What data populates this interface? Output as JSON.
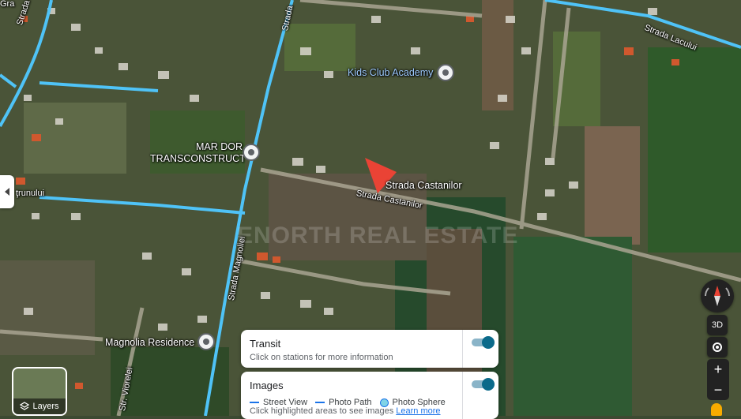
{
  "map": {
    "street_labels": {
      "strada_hoiia": "Strada Hoiia",
      "strada_lacului": "Strada Lacului",
      "strada_castanilor": "Strada Castanilor",
      "strada_magnoliei": "Strada Magnoliei",
      "str_viorelei": "Str. Viorelei",
      "gra": "Gra",
      "frunului": "ţrunului",
      "strada_top": "Strada"
    },
    "places": {
      "kids_club": "Kids Club Academy",
      "mar_dor_line1": "MAR DOR",
      "mar_dor_line2": "TRANSCONSTRUCT",
      "magnolia": "Magnolia Residence",
      "pin_label": "Strada Castanilor"
    },
    "watermark": "ENORTH REAL ESTATE",
    "colors": {
      "road_highlight": "#4fc3f7",
      "pin": "#ea4335"
    }
  },
  "controls": {
    "compass_icon": "compass-icon",
    "btn_3d": "3D",
    "zoom_in": "+",
    "zoom_out": "−",
    "layers_label": "Layers"
  },
  "panel": {
    "transit": {
      "title": "Transit",
      "subtitle": "Click on stations for more information",
      "enabled": true
    },
    "images": {
      "title": "Images",
      "legend": [
        "Street View",
        "Photo Path",
        "Photo Sphere"
      ],
      "subtitle": "Click highlighted areas to see images",
      "link": "Learn more",
      "enabled": true
    }
  }
}
